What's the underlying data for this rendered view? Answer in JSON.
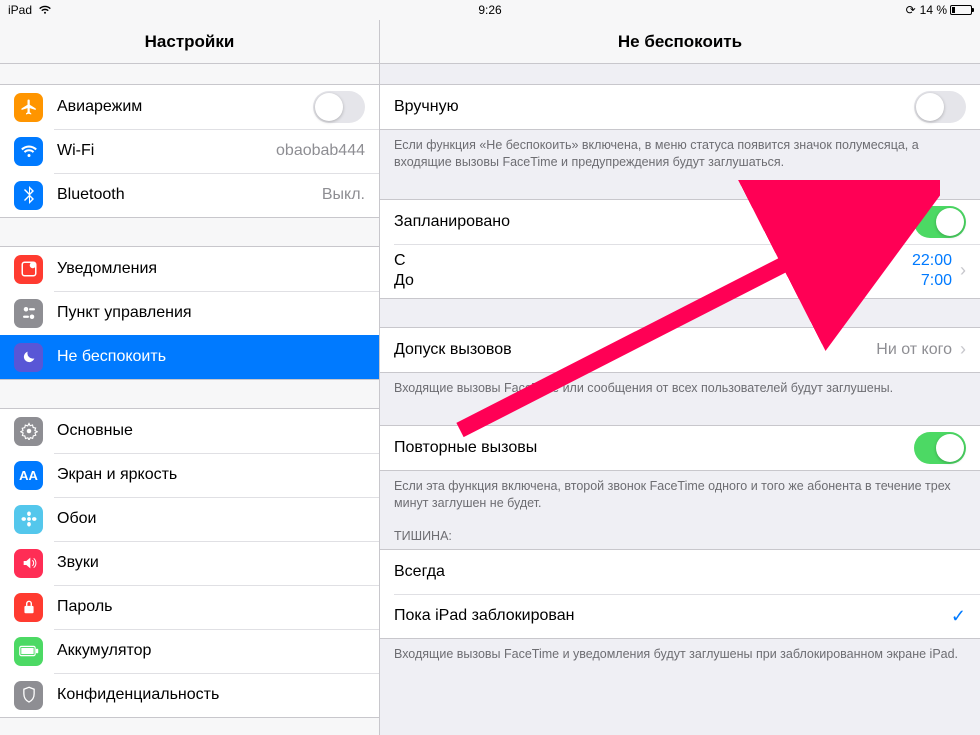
{
  "statusbar": {
    "device": "iPad",
    "time": "9:26",
    "battery_pct": "14 %",
    "lock_icon": "⊕"
  },
  "sidebar": {
    "title": "Настройки",
    "items": [
      {
        "label": "Авиарежим",
        "icon_bg": "#ff9500",
        "icon": "plane",
        "switch": false
      },
      {
        "label": "Wi-Fi",
        "icon_bg": "#007aff",
        "icon": "wifi",
        "value": "obaobab444"
      },
      {
        "label": "Bluetooth",
        "icon_bg": "#007aff",
        "icon": "bt",
        "value": "Выкл."
      }
    ],
    "items2": [
      {
        "label": "Уведомления",
        "icon_bg": "#ff3b30",
        "icon": "notif"
      },
      {
        "label": "Пункт управления",
        "icon_bg": "#8e8e93",
        "icon": "control"
      },
      {
        "label": "Не беспокоить",
        "icon_bg": "#5856d6",
        "icon": "moon",
        "selected": true
      }
    ],
    "items3": [
      {
        "label": "Основные",
        "icon_bg": "#8e8e93",
        "icon": "gear"
      },
      {
        "label": "Экран и яркость",
        "icon_bg": "#007aff",
        "icon": "aa"
      },
      {
        "label": "Обои",
        "icon_bg": "#54c7ec",
        "icon": "flower"
      },
      {
        "label": "Звуки",
        "icon_bg": "#ff2d55",
        "icon": "sound"
      },
      {
        "label": "Пароль",
        "icon_bg": "#ff3b30",
        "icon": "lock"
      },
      {
        "label": "Аккумулятор",
        "icon_bg": "#4cd964",
        "icon": "batt"
      },
      {
        "label": "Конфиденциальность",
        "icon_bg": "#8e8e93",
        "icon": "hand"
      }
    ]
  },
  "detail": {
    "title": "Не беспокоить",
    "manual": {
      "label": "Вручную",
      "on": false
    },
    "manual_footer": "Если функция «Не беспокоить» включена, в меню статуса появится значок полумесяца, а входящие вызовы FaceTime и предупреждения будут заглушаться.",
    "scheduled": {
      "label": "Запланировано",
      "on": true
    },
    "from_label": "С",
    "to_label": "До",
    "from_time": "22:00",
    "to_time": "7:00",
    "allow_calls": {
      "label": "Допуск вызовов",
      "value": "Ни от кого"
    },
    "allow_footer": "Входящие вызовы FaceTime или сообщения от всех пользователей будут заглушены.",
    "repeated": {
      "label": "Повторные вызовы",
      "on": true
    },
    "repeated_footer": "Если эта функция включена, второй звонок FaceTime одного и того же абонента в течение трех минут заглушен не будет.",
    "silence_header": "ТИШИНА:",
    "silence_options": [
      {
        "label": "Всегда",
        "checked": false
      },
      {
        "label": "Пока iPad заблокирован",
        "checked": true
      }
    ],
    "silence_footer": "Входящие вызовы FaceTime и уведомления будут заглушены при заблокированном экране iPad."
  }
}
